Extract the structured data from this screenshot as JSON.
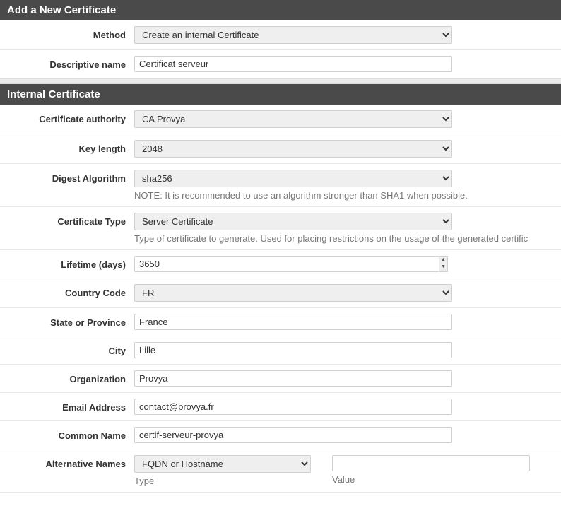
{
  "panel1": {
    "title": "Add a New Certificate",
    "method_label": "Method",
    "method_value": "Create an internal Certificate",
    "name_label": "Descriptive name",
    "name_value": "Certificat serveur"
  },
  "panel2": {
    "title": "Internal Certificate",
    "ca_label": "Certificate authority",
    "ca_value": "CA Provya",
    "keylen_label": "Key length",
    "keylen_value": "2048",
    "digest_label": "Digest Algorithm",
    "digest_value": "sha256",
    "digest_help": "NOTE: It is recommended to use an algorithm stronger than SHA1 when possible.",
    "certtype_label": "Certificate Type",
    "certtype_value": "Server Certificate",
    "certtype_help": "Type of certificate to generate. Used for placing restrictions on the usage of the generated certific",
    "lifetime_label": "Lifetime (days)",
    "lifetime_value": "3650",
    "country_label": "Country Code",
    "country_value": "FR",
    "state_label": "State or Province",
    "state_value": "France",
    "city_label": "City",
    "city_value": "Lille",
    "org_label": "Organization",
    "org_value": "Provya",
    "email_label": "Email Address",
    "email_value": "contact@provya.fr",
    "cn_label": "Common Name",
    "cn_value": "certif-serveur-provya",
    "altnames_label": "Alternative Names",
    "altnames_type_value": "FQDN or Hostname",
    "altnames_type_help": "Type",
    "altnames_value_value": "",
    "altnames_value_help": "Value"
  }
}
